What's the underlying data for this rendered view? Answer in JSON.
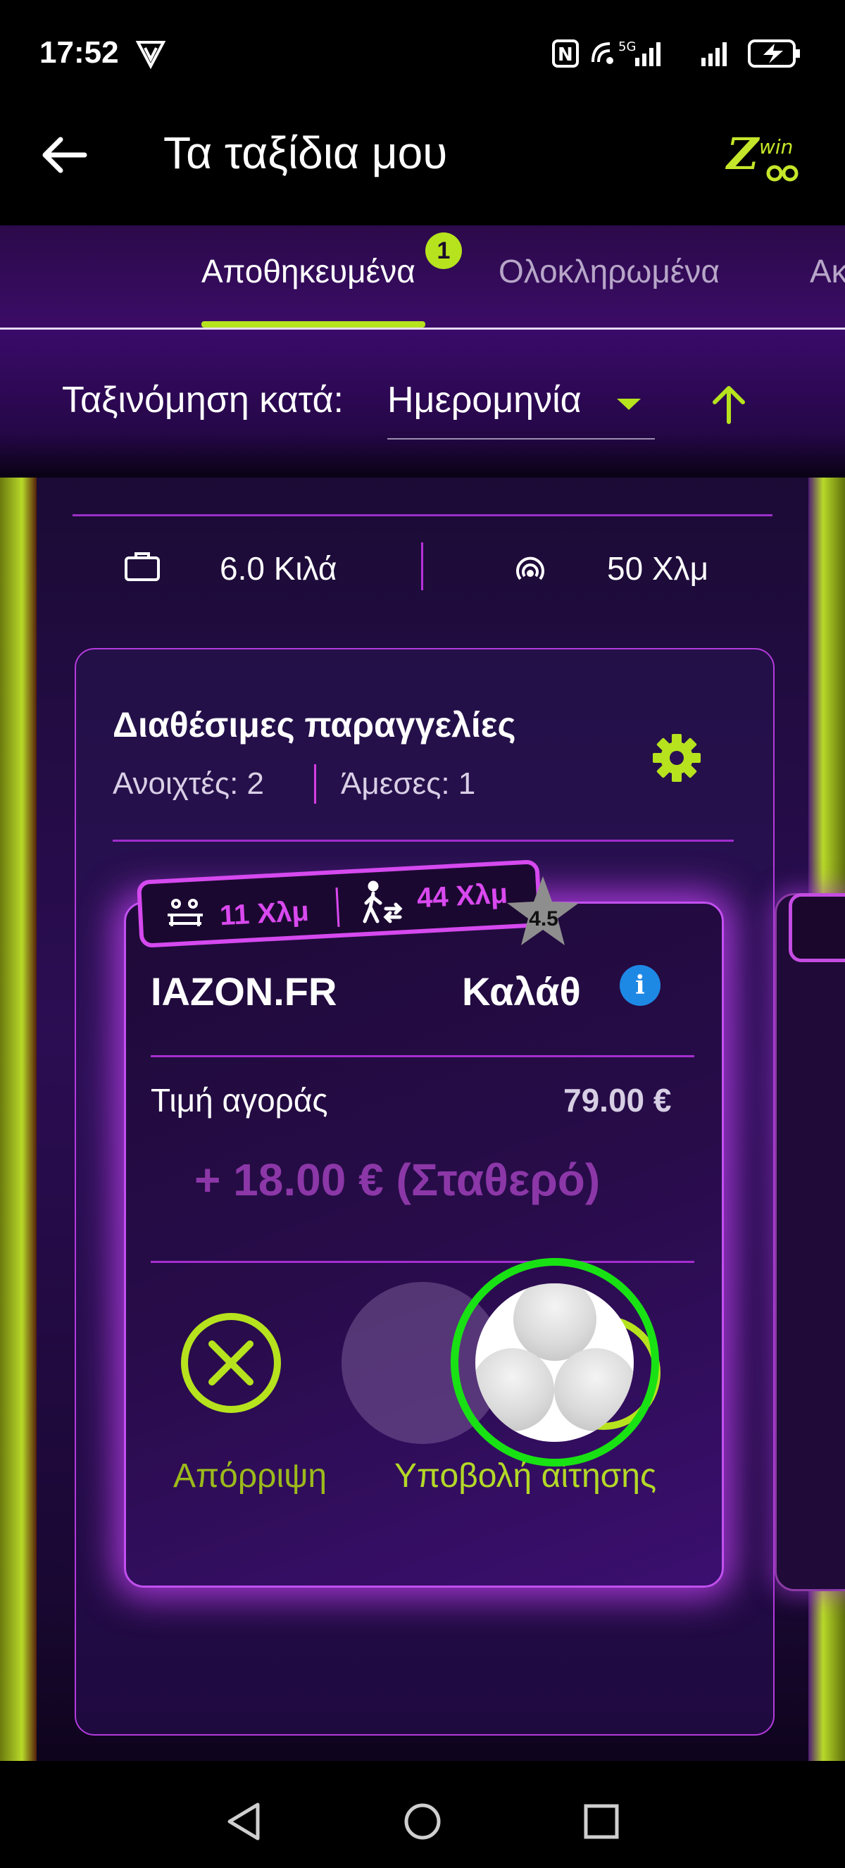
{
  "status_bar": {
    "time": "17:52"
  },
  "header": {
    "title": "Τα ταξίδια μου",
    "logo_text": "Zwin"
  },
  "tabs": [
    {
      "label": "Αποθηκευμένα",
      "badge": "1",
      "selected": true
    },
    {
      "label": "Ολοκληρωμένα",
      "selected": false
    },
    {
      "label": "Ακ",
      "selected": false
    }
  ],
  "sort": {
    "label": "Ταξινόμηση κατά:",
    "value": "Ημερομηνία"
  },
  "trip_summary": {
    "weight": "6.0 Κιλά",
    "range": "50 Χλμ"
  },
  "orders": {
    "title": "Διαθέσιμες παραγγελίες",
    "open": "Ανοιχτές: 2",
    "direct": "Άμεσες: 1"
  },
  "offer": {
    "distance_1": "11 Χλμ",
    "distance_2": "44 Χλμ",
    "rating": "4.5",
    "store": "IAZON.FR",
    "product": "Καλάθ",
    "price_label": "Τιμή αγοράς",
    "price_value": "79.00 €",
    "bonus": "+ 18.00 € (Σταθερό)",
    "reject_label": "Απόρριψη",
    "accept_label": "Υποβολή αίτησης"
  },
  "colors": {
    "accent": "#b6e31e",
    "purple": "#d949ef",
    "background": "#1b0b35"
  }
}
